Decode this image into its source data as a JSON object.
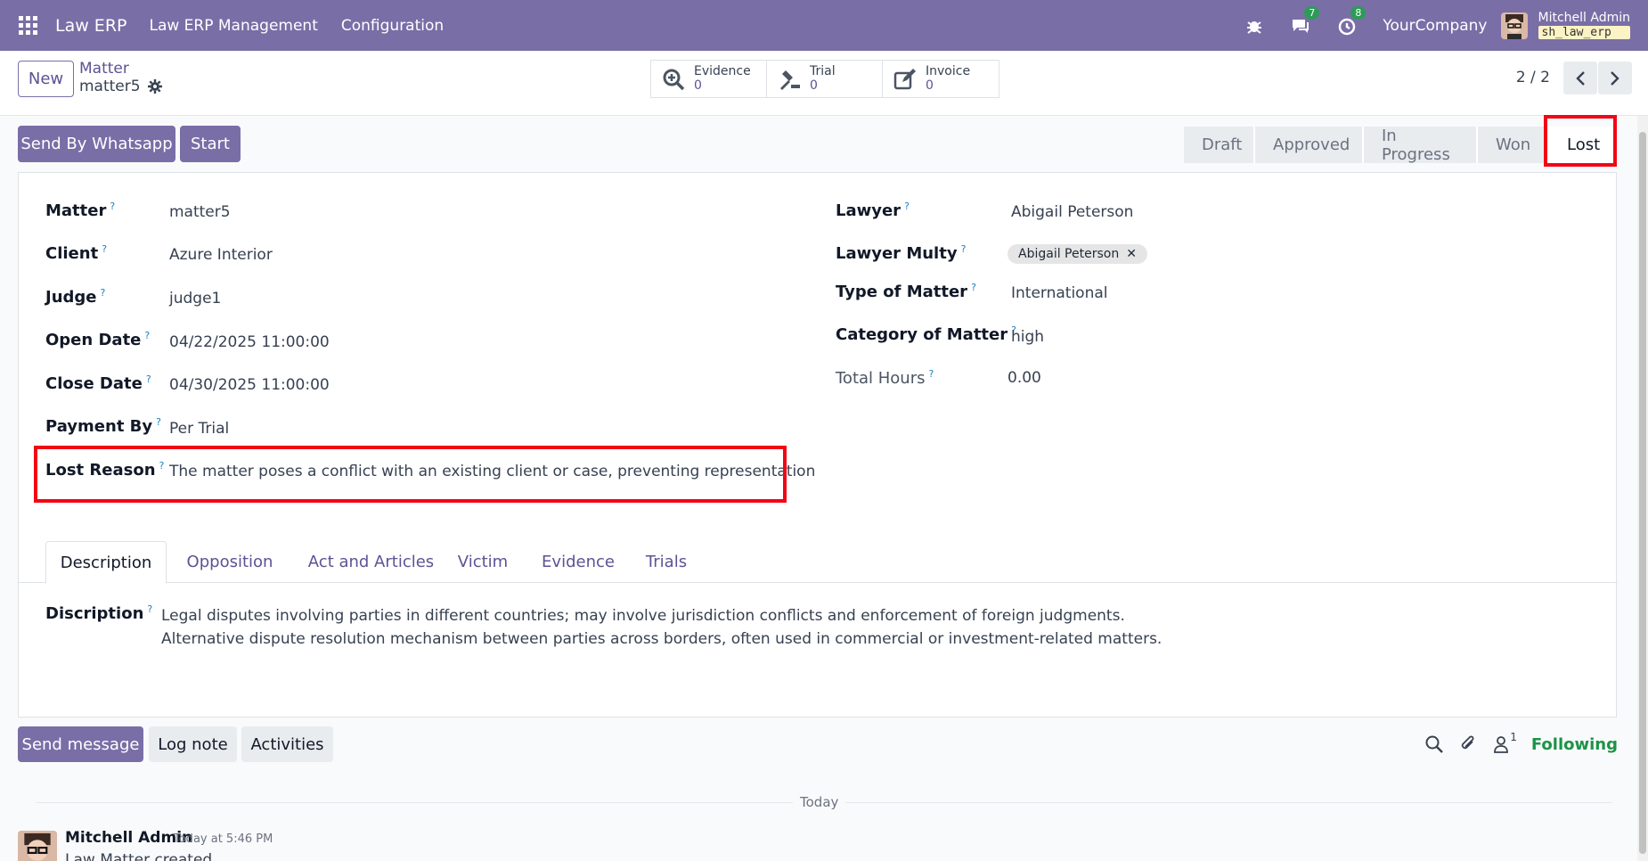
{
  "topbar": {
    "app_name": "Law ERP",
    "menu": [
      "Law ERP Management",
      "Configuration"
    ],
    "chat_badge": "7",
    "activity_badge": "8",
    "company": "YourCompany",
    "user_name": "Mitchell Admin",
    "db_name": "sh_law_erp"
  },
  "control": {
    "new_label": "New",
    "breadcrumb_parent": "Matter",
    "breadcrumb_current": "matter5",
    "smart_buttons": [
      {
        "label": "Evidence",
        "count": "0",
        "icon": "search-plus-icon"
      },
      {
        "label": "Trial",
        "count": "0",
        "icon": "gavel-icon"
      },
      {
        "label": "Invoice",
        "count": "0",
        "icon": "edit-icon"
      }
    ],
    "pager": "2 / 2"
  },
  "actions": {
    "whatsapp_label": "Send By Whatsapp",
    "start_label": "Start"
  },
  "status": {
    "stages": [
      "Draft",
      "Approved",
      "In Progress",
      "Won",
      "Lost"
    ],
    "active": "Lost"
  },
  "form": {
    "left": [
      {
        "label": "Matter",
        "value": "matter5"
      },
      {
        "label": "Client",
        "value": "Azure Interior"
      },
      {
        "label": "Judge",
        "value": "judge1"
      },
      {
        "label": "Open Date",
        "value": "04/22/2025 11:00:00"
      },
      {
        "label": "Close Date",
        "value": "04/30/2025 11:00:00"
      },
      {
        "label": "Payment By",
        "value": "Per Trial"
      },
      {
        "label": "Lost Reason",
        "value": "The matter poses a conflict with an existing client or case, preventing representation"
      }
    ],
    "right": [
      {
        "label": "Lawyer",
        "value": "Abigail Peterson"
      },
      {
        "label": "Lawyer Multy",
        "value": "Abigail Peterson"
      },
      {
        "label": "Type of Matter",
        "value": "International"
      },
      {
        "label": "Category of Matter",
        "value": "high"
      },
      {
        "label": "Total Hours",
        "value": "0.00"
      }
    ],
    "help_mark": "?"
  },
  "tabs": {
    "items": [
      "Description",
      "Opposition",
      "Act and Articles",
      "Victim",
      "Evidence",
      "Trials"
    ],
    "active": "Description"
  },
  "description": {
    "label": "Discription",
    "lines": [
      "Legal disputes involving parties in different countries; may involve jurisdiction conflicts and enforcement of foreign judgments.",
      "Alternative dispute resolution mechanism between parties across borders, often used in commercial or investment-related matters."
    ]
  },
  "chatter": {
    "send_message": "Send message",
    "log_note": "Log note",
    "activities": "Activities",
    "follower_count": "1",
    "following": "Following",
    "today": "Today",
    "author": "Mitchell Admin",
    "time": "Today at 5:46 PM",
    "body": "Law Matter created"
  },
  "colors": {
    "brand": "#7a6ea7",
    "highlight": "#f20515",
    "following": "#1c9347"
  }
}
